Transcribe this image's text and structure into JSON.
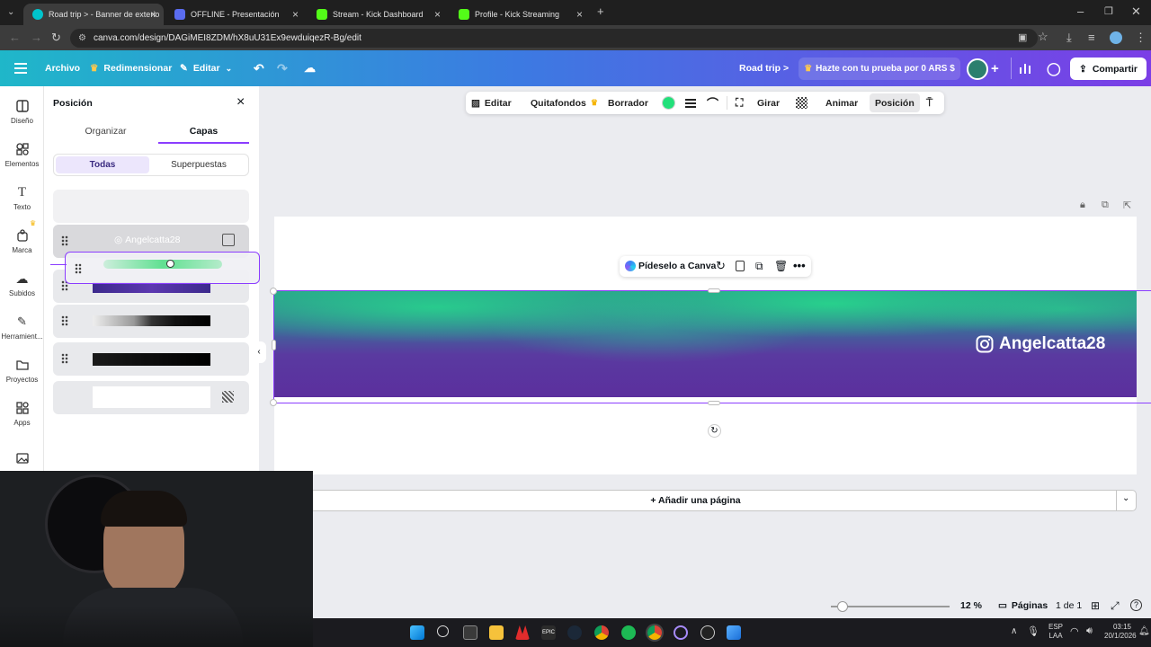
{
  "browser": {
    "tabs": [
      {
        "title": "Road trip > - Banner de exterio",
        "active": true
      },
      {
        "title": "OFFLINE - Presentación",
        "active": false
      },
      {
        "title": "Stream - Kick Dashboard",
        "active": false
      },
      {
        "title": "Profile - Kick Streaming",
        "active": false
      }
    ],
    "url": "canva.com/design/DAGiMEI8ZDM/hX8uU31Ex9ewduiqezR-Bg/edit"
  },
  "topbar": {
    "archivo": "Archivo",
    "redimensionar": "Redimensionar",
    "editar": "Editar",
    "design_title": "Road trip >",
    "trial": "Hazte con tu prueba por 0 ARS $",
    "share": "Compartir"
  },
  "rail": [
    {
      "label": "Diseño",
      "icon": "design-icon"
    },
    {
      "label": "Elementos",
      "icon": "elements-icon"
    },
    {
      "label": "Texto",
      "icon": "text-icon"
    },
    {
      "label": "Marca",
      "icon": "brand-icon"
    },
    {
      "label": "Subidos",
      "icon": "upload-icon"
    },
    {
      "label": "Herramient...",
      "icon": "tools-icon"
    },
    {
      "label": "Proyectos",
      "icon": "folder-icon"
    },
    {
      "label": "Apps",
      "icon": "apps-icon"
    }
  ],
  "panel": {
    "title": "Posición",
    "tabs": [
      "Organizar",
      "Capas"
    ],
    "active_tab": "Capas",
    "filters": [
      "Todas",
      "Superpuestas"
    ],
    "layer_text": "Angelcatta28"
  },
  "toolbar": {
    "editar": "Editar",
    "quitafondos": "Quitafondos",
    "borrador": "Borrador",
    "color": "#22e07a",
    "girar": "Girar",
    "animar": "Animar",
    "posicion": "Posición"
  },
  "canvas": {
    "ask": "Pídeselo a Canva",
    "handle": "Angelcatta28",
    "add_page": "+ Añadir una página"
  },
  "footer": {
    "zoom": "12 %",
    "pages_label": "Páginas",
    "page_count": "1 de 1"
  },
  "taskbar": {
    "lang1": "ESP",
    "lang2": "LAA",
    "time": "03:15",
    "date": "20/1/2026"
  }
}
